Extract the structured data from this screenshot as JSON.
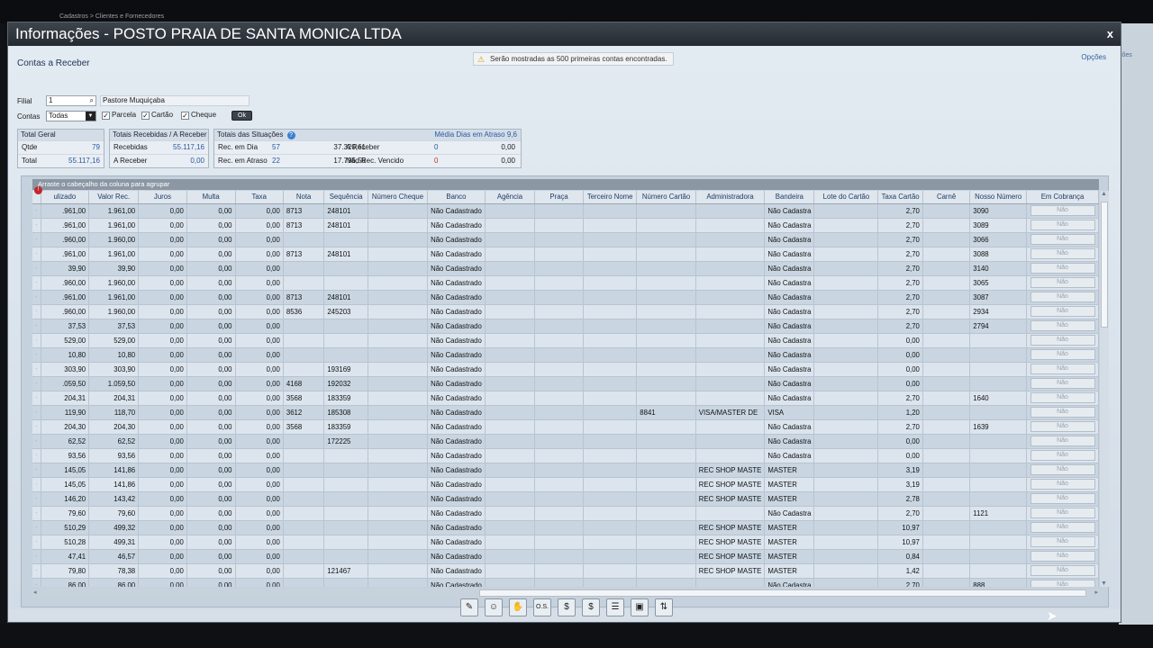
{
  "breadcrumb": "Cadastros > Clientes e Fornecedores",
  "window": {
    "title": "Informações - POSTO PRAIA DE SANTA MONICA LTDA",
    "close": "x"
  },
  "outer_right_label": "ções",
  "section_title": "Contas a Receber",
  "notice": "Serão mostradas as 500 primeiras contas encontradas.",
  "options_link": "Opções",
  "filters": {
    "filial_label": "Filial",
    "filial_value": "1",
    "filial_name": "Pastore Muquiçaba",
    "contas_label": "Contas",
    "contas_value": "Todas",
    "parcela_label": "Parcela",
    "cartao_label": "Cartão",
    "cheque_label": "Cheque",
    "check_mark": "✓",
    "ok_label": "Ok"
  },
  "total_geral": {
    "title": "Total Geral",
    "qtde_label": "Qtde",
    "qtde_value": "79",
    "total_label": "Total",
    "total_value": "55.117,16"
  },
  "totais_receb": {
    "title": "Totais Recebidas / A Receber",
    "recebidas_label": "Recebidas",
    "recebidas_value": "55.117,16",
    "areceber_label": "A Receber",
    "areceber_value": "0,00"
  },
  "totais_sit": {
    "title": "Totais das Situações",
    "media_label": "Média Dias em Atraso",
    "media_value": "9,6",
    "rec_dia_label": "Rec. em Dia",
    "rec_dia_count": "57",
    "rec_dia_value": "37.320,61",
    "rec_atraso_label": "Rec. em Atraso",
    "rec_atraso_count": "22",
    "rec_atraso_value": "17.796,56",
    "a_receber_label": "A Receber",
    "a_receber_count": "0",
    "a_receber_value": "0,00",
    "nao_rec_label": "Não Rec. Vencido",
    "nao_rec_count": "0",
    "nao_rec_value": "0,00"
  },
  "group_hint": "Arraste o cabeçalho da coluna para agrupar",
  "columns": [
    "",
    "ulizado",
    "Valor Rec.",
    "Juros",
    "Multa",
    "Taxa",
    "Nota",
    "Sequência",
    "Número Cheque",
    "Banco",
    "Agência",
    "Praça",
    "Terceiro Nome",
    "Número Cartão",
    "Administradora",
    "Bandeira",
    "Lote do Cartão",
    "Taxa Cartão",
    "Carnê",
    "Nosso Número",
    "Em Cobrança"
  ],
  "rows": [
    [
      ".961,00",
      "1.961,00",
      "0,00",
      "0,00",
      "0,00",
      "8713",
      "248101",
      "",
      "Não Cadastrado",
      "",
      "",
      "",
      "",
      "",
      "Não Cadastra",
      "",
      "2,70",
      "",
      "3090",
      "Não"
    ],
    [
      ".961,00",
      "1.961,00",
      "0,00",
      "0,00",
      "0,00",
      "8713",
      "248101",
      "",
      "Não Cadastrado",
      "",
      "",
      "",
      "",
      "",
      "Não Cadastra",
      "",
      "2,70",
      "",
      "3089",
      "Não"
    ],
    [
      ".960,00",
      "1.960,00",
      "0,00",
      "0,00",
      "0,00",
      "",
      "",
      "",
      "Não Cadastrado",
      "",
      "",
      "",
      "",
      "",
      "Não Cadastra",
      "",
      "2,70",
      "",
      "3066",
      "Não"
    ],
    [
      ".961,00",
      "1.961,00",
      "0,00",
      "0,00",
      "0,00",
      "8713",
      "248101",
      "",
      "Não Cadastrado",
      "",
      "",
      "",
      "",
      "",
      "Não Cadastra",
      "",
      "2,70",
      "",
      "3088",
      "Não"
    ],
    [
      "39,90",
      "39,90",
      "0,00",
      "0,00",
      "0,00",
      "",
      "",
      "",
      "Não Cadastrado",
      "",
      "",
      "",
      "",
      "",
      "Não Cadastra",
      "",
      "2,70",
      "",
      "3140",
      "Não"
    ],
    [
      ".960,00",
      "1.960,00",
      "0,00",
      "0,00",
      "0,00",
      "",
      "",
      "",
      "Não Cadastrado",
      "",
      "",
      "",
      "",
      "",
      "Não Cadastra",
      "",
      "2,70",
      "",
      "3065",
      "Não"
    ],
    [
      ".961,00",
      "1.961,00",
      "0,00",
      "0,00",
      "0,00",
      "8713",
      "248101",
      "",
      "Não Cadastrado",
      "",
      "",
      "",
      "",
      "",
      "Não Cadastra",
      "",
      "2,70",
      "",
      "3087",
      "Não"
    ],
    [
      ".960,00",
      "1.960,00",
      "0,00",
      "0,00",
      "0,00",
      "8536",
      "245203",
      "",
      "Não Cadastrado",
      "",
      "",
      "",
      "",
      "",
      "Não Cadastra",
      "",
      "2,70",
      "",
      "2934",
      "Não"
    ],
    [
      "37,53",
      "37,53",
      "0,00",
      "0,00",
      "0,00",
      "",
      "",
      "",
      "Não Cadastrado",
      "",
      "",
      "",
      "",
      "",
      "Não Cadastra",
      "",
      "2,70",
      "",
      "2794",
      "Não"
    ],
    [
      "529,00",
      "529,00",
      "0,00",
      "0,00",
      "0,00",
      "",
      "",
      "",
      "Não Cadastrado",
      "",
      "",
      "",
      "",
      "",
      "Não Cadastra",
      "",
      "0,00",
      "",
      "",
      "Não"
    ],
    [
      "10,80",
      "10,80",
      "0,00",
      "0,00",
      "0,00",
      "",
      "",
      "",
      "Não Cadastrado",
      "",
      "",
      "",
      "",
      "",
      "Não Cadastra",
      "",
      "0,00",
      "",
      "",
      "Não"
    ],
    [
      "303,90",
      "303,90",
      "0,00",
      "0,00",
      "0,00",
      "",
      "193169",
      "",
      "Não Cadastrado",
      "",
      "",
      "",
      "",
      "",
      "Não Cadastra",
      "",
      "0,00",
      "",
      "",
      "Não"
    ],
    [
      ".059,50",
      "1.059,50",
      "0,00",
      "0,00",
      "0,00",
      "4168",
      "192032",
      "",
      "Não Cadastrado",
      "",
      "",
      "",
      "",
      "",
      "Não Cadastra",
      "",
      "0,00",
      "",
      "",
      "Não"
    ],
    [
      "204,31",
      "204,31",
      "0,00",
      "0,00",
      "0,00",
      "3568",
      "183359",
      "",
      "Não Cadastrado",
      "",
      "",
      "",
      "",
      "",
      "Não Cadastra",
      "",
      "2,70",
      "",
      "1640",
      "Não"
    ],
    [
      "119,90",
      "118,70",
      "0,00",
      "0,00",
      "0,00",
      "3612",
      "185308",
      "",
      "Não Cadastrado",
      "",
      "",
      "",
      "8841",
      "VISA/MASTER DE",
      "VISA",
      "",
      "1,20",
      "",
      "",
      "Não"
    ],
    [
      "204,30",
      "204,30",
      "0,00",
      "0,00",
      "0,00",
      "3568",
      "183359",
      "",
      "Não Cadastrado",
      "",
      "",
      "",
      "",
      "",
      "Não Cadastra",
      "",
      "2,70",
      "",
      "1639",
      "Não"
    ],
    [
      "62,52",
      "62,52",
      "0,00",
      "0,00",
      "0,00",
      "",
      "172225",
      "",
      "Não Cadastrado",
      "",
      "",
      "",
      "",
      "",
      "Não Cadastra",
      "",
      "0,00",
      "",
      "",
      "Não"
    ],
    [
      "93,56",
      "93,56",
      "0,00",
      "0,00",
      "0,00",
      "",
      "",
      "",
      "Não Cadastrado",
      "",
      "",
      "",
      "",
      "",
      "Não Cadastra",
      "",
      "0,00",
      "",
      "",
      "Não"
    ],
    [
      "145,05",
      "141,86",
      "0,00",
      "0,00",
      "0,00",
      "",
      "",
      "",
      "Não Cadastrado",
      "",
      "",
      "",
      "",
      "REC SHOP MASTE",
      "MASTER",
      "",
      "3,19",
      "",
      "",
      "Não"
    ],
    [
      "145,05",
      "141,86",
      "0,00",
      "0,00",
      "0,00",
      "",
      "",
      "",
      "Não Cadastrado",
      "",
      "",
      "",
      "",
      "REC SHOP MASTE",
      "MASTER",
      "",
      "3,19",
      "",
      "",
      "Não"
    ],
    [
      "146,20",
      "143,42",
      "0,00",
      "0,00",
      "0,00",
      "",
      "",
      "",
      "Não Cadastrado",
      "",
      "",
      "",
      "",
      "REC SHOP MASTE",
      "MASTER",
      "",
      "2,78",
      "",
      "",
      "Não"
    ],
    [
      "79,60",
      "79,60",
      "0,00",
      "0,00",
      "0,00",
      "",
      "",
      "",
      "Não Cadastrado",
      "",
      "",
      "",
      "",
      "",
      "Não Cadastra",
      "",
      "2,70",
      "",
      "1121",
      "Não"
    ],
    [
      "510,29",
      "499,32",
      "0,00",
      "0,00",
      "0,00",
      "",
      "",
      "",
      "Não Cadastrado",
      "",
      "",
      "",
      "",
      "REC SHOP MASTE",
      "MASTER",
      "",
      "10,97",
      "",
      "",
      "Não"
    ],
    [
      "510,28",
      "499,31",
      "0,00",
      "0,00",
      "0,00",
      "",
      "",
      "",
      "Não Cadastrado",
      "",
      "",
      "",
      "",
      "REC SHOP MASTE",
      "MASTER",
      "",
      "10,97",
      "",
      "",
      "Não"
    ],
    [
      "47,41",
      "46,57",
      "0,00",
      "0,00",
      "0,00",
      "",
      "",
      "",
      "Não Cadastrado",
      "",
      "",
      "",
      "",
      "REC SHOP MASTE",
      "MASTER",
      "",
      "0,84",
      "",
      "",
      "Não"
    ],
    [
      "79,80",
      "78,38",
      "0,00",
      "0,00",
      "0,00",
      "",
      "121467",
      "",
      "Não Cadastrado",
      "",
      "",
      "",
      "",
      "REC SHOP MASTE",
      "MASTER",
      "",
      "1,42",
      "",
      "",
      "Não"
    ],
    [
      "86,00",
      "86,00",
      "0,00",
      "0,00",
      "0,00",
      "",
      "",
      "",
      "Não Cadastrado",
      "",
      "",
      "",
      "",
      "",
      "Não Cadastra",
      "",
      "2,70",
      "",
      "888",
      "Não"
    ]
  ],
  "toolbar": [
    {
      "name": "edit",
      "glyph": "✎"
    },
    {
      "name": "person",
      "glyph": "☺"
    },
    {
      "name": "hand",
      "glyph": "✋"
    },
    {
      "name": "os",
      "glyph": "O.S."
    },
    {
      "name": "money-in",
      "glyph": "$"
    },
    {
      "name": "money-out",
      "glyph": "$"
    },
    {
      "name": "document",
      "glyph": "☰"
    },
    {
      "name": "cart",
      "glyph": "▣"
    },
    {
      "name": "transfer",
      "glyph": "⇅"
    }
  ]
}
